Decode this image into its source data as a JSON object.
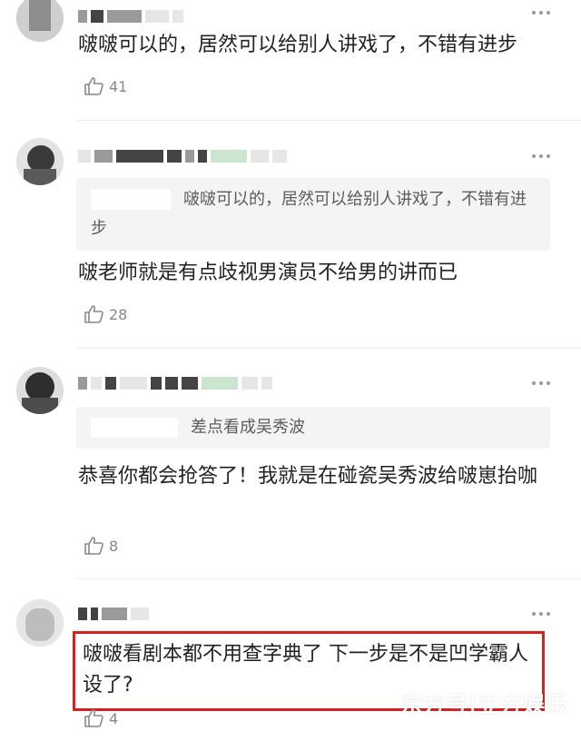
{
  "comments": [
    {
      "text": "啵啵可以的，居然可以给别人讲戏了，不错有进步",
      "likes": "41"
    },
    {
      "quote": "啵啵可以的，居然可以给别人讲戏了，不错有进步",
      "text": "啵老师就是有点歧视男演员不给男的讲而已",
      "likes": "28"
    },
    {
      "quote": "差点看成吴秀波",
      "text": "恭喜你都会抢答了！我就是在碰瓷吴秀波给啵崽抬咖",
      "likes": "8"
    },
    {
      "text": "啵啵看剧本都不用查字典了 下一步是不是凹学霸人设了?",
      "likes": "4"
    }
  ],
  "watermark": "东方号|立方娱乐",
  "icons": {
    "like": "thumbs-up-icon",
    "more": "more-dots-icon"
  },
  "colors": {
    "highlight_border": "#d62020",
    "quote_bg": "#f4f4f4",
    "meta_text": "#888888"
  }
}
